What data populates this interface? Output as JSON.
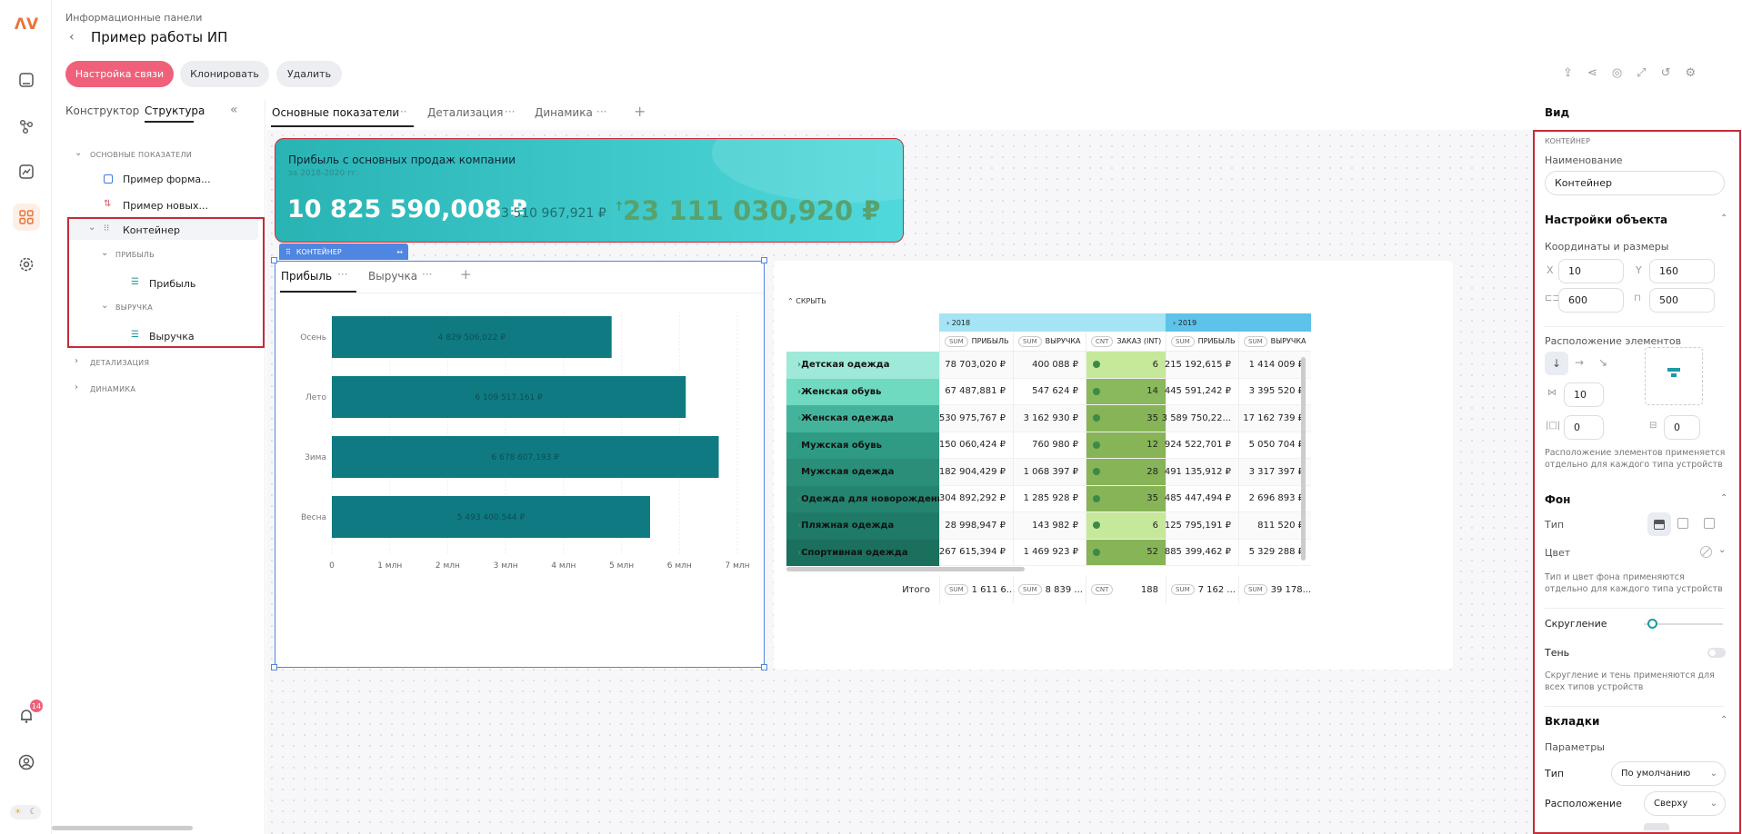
{
  "app": {
    "breadcrumb": "Информационные панели",
    "title": "Пример работы ИП"
  },
  "actions": {
    "link": "Настройка связи",
    "clone": "Клонировать",
    "delete": "Удалить"
  },
  "notifications": {
    "count": "14"
  },
  "structure": {
    "tabs": [
      "Конструктор",
      "Структура"
    ],
    "items": [
      {
        "label": "ОСНОВНЫЕ ПОКАЗАТЕЛИ"
      },
      {
        "label": "Пример форма..."
      },
      {
        "label": "Пример новых..."
      },
      {
        "label": "Контейнер"
      },
      {
        "label": "ПРИБЫЛЬ"
      },
      {
        "label": "Прибыль"
      },
      {
        "label": "ВЫРУЧКА"
      },
      {
        "label": "Выручка"
      },
      {
        "label": "ДЕТАЛИЗАЦИЯ"
      },
      {
        "label": "ДИНАМИКА"
      }
    ]
  },
  "page_tabs": [
    "Основные показатели",
    "Детализация",
    "Динамика"
  ],
  "kpi": {
    "title": "Прибыль с основных продаж компании",
    "subtitle": "за 2018-2020 гг.",
    "value": "10 825 590,008 ₽",
    "prev": "3 510 967,921 ₽",
    "delta": "23 111 030,920 ₽"
  },
  "container": {
    "label": "КОНТЕЙНЕР",
    "tabs": [
      "Прибыль",
      "Выручка"
    ]
  },
  "chart_data": {
    "type": "bar",
    "orientation": "horizontal",
    "categories": [
      "Осень",
      "Лето",
      "Зима",
      "Весна"
    ],
    "values": [
      4829506.022,
      6109517.161,
      6678607.193,
      5493400.544
    ],
    "labels": [
      "4 829 506,022 ₽",
      "6 109 517,161 ₽",
      "6 678 607,193 ₽",
      "5 493 400,544 ₽"
    ],
    "xticks": [
      "0",
      "1 млн",
      "2 млн",
      "3 млн",
      "4 млн",
      "5 млн",
      "6 млн",
      "7 млн"
    ],
    "xlim": [
      0,
      7000000
    ],
    "color": "#0f7a82",
    "grid": true
  },
  "pivot": {
    "hide_label": "СКРЫТЬ",
    "years": [
      "2018",
      "2019"
    ],
    "columns": [
      {
        "agg": "SUM",
        "name": "ПРИБЫЛЬ"
      },
      {
        "agg": "SUM",
        "name": "ВЫРУЧКА"
      },
      {
        "agg": "CNT",
        "name": "ЗАКАЗ (INT)"
      },
      {
        "agg": "SUM",
        "name": "ПРИБЫЛЬ"
      },
      {
        "agg": "SUM",
        "name": "ВЫРУЧКА"
      }
    ],
    "rows": [
      {
        "name": "Детская одежда",
        "c": [
          "78 703,020 ₽",
          "400 088 ₽",
          "6",
          "215 192,615 ₽",
          "1 414 009 ₽"
        ]
      },
      {
        "name": "Женская обувь",
        "c": [
          "67 487,881 ₽",
          "547 624 ₽",
          "14",
          "445 591,242 ₽",
          "3 395 520 ₽"
        ]
      },
      {
        "name": "Женская одежда",
        "c": [
          "530 975,767 ₽",
          "3 162 930 ₽",
          "35",
          "3 589 750,22...",
          "17 162 739 ₽"
        ]
      },
      {
        "name": "Мужская обувь",
        "c": [
          "150 060,424 ₽",
          "760 980 ₽",
          "12",
          "924 522,701 ₽",
          "5 050 704 ₽"
        ]
      },
      {
        "name": "Мужская одежда",
        "c": [
          "182 904,429 ₽",
          "1 068 397 ₽",
          "28",
          "491 135,912 ₽",
          "3 317 397 ₽"
        ]
      },
      {
        "name": "Одежда для новорожденных",
        "c": [
          "304 892,292 ₽",
          "1 285 928 ₽",
          "35",
          "485 447,494 ₽",
          "2 696 893 ₽"
        ]
      },
      {
        "name": "Пляжная одежда",
        "c": [
          "28 998,947 ₽",
          "143 982 ₽",
          "6",
          "125 795,191 ₽",
          "811 520 ₽"
        ]
      },
      {
        "name": "Спортивная одежда",
        "c": [
          "267 615,394 ₽",
          "1 469 923 ₽",
          "52",
          "885 399,462 ₽",
          "5 329 288 ₽"
        ]
      }
    ],
    "total_label": "Итого",
    "totals": [
      {
        "agg": "SUM",
        "value": "1 611 6..."
      },
      {
        "agg": "SUM",
        "value": "8 839 ..."
      },
      {
        "agg": "CNT",
        "value": "188"
      },
      {
        "agg": "SUM",
        "value": "7 162 ..."
      },
      {
        "agg": "SUM",
        "value": "39 178..."
      }
    ]
  },
  "panel": {
    "header": "Вид",
    "section_caption": "КОНТЕЙНЕР",
    "name_label": "Наименование",
    "name_value": "Контейнер",
    "object_settings": "Настройки объекта",
    "coords_label": "Координаты и размеры",
    "x_label": "X",
    "x": "10",
    "y_label": "Y",
    "y": "160",
    "w": "600",
    "h": "500",
    "layout_label": "Расположение элементов",
    "gap": "10",
    "pad_x": "0",
    "pad_y": "0",
    "layout_note": "Расположение элементов применяется отдельно для каждого типа устройств",
    "bg_header": "Фон",
    "type_label": "Тип",
    "color_label": "Цвет",
    "bg_note": "Тип и цвет фона применяются отдельно для каждого типа устройств",
    "radius_label": "Скругление",
    "shadow_label": "Тень",
    "radius_note": "Скругление и тень применяются для всех типов устройств",
    "tabs_header": "Вкладки",
    "params_label": "Параметры",
    "tab_type_label": "Тип",
    "tab_type_value": "По умолчанию",
    "tab_pos_label": "Расположение",
    "tab_pos_value": "Сверху"
  },
  "colors": {
    "accent": "#f0607a",
    "highlight_border": "#c62b3a",
    "teal": "#0f7a82",
    "container_blue": "#4f86e0"
  }
}
